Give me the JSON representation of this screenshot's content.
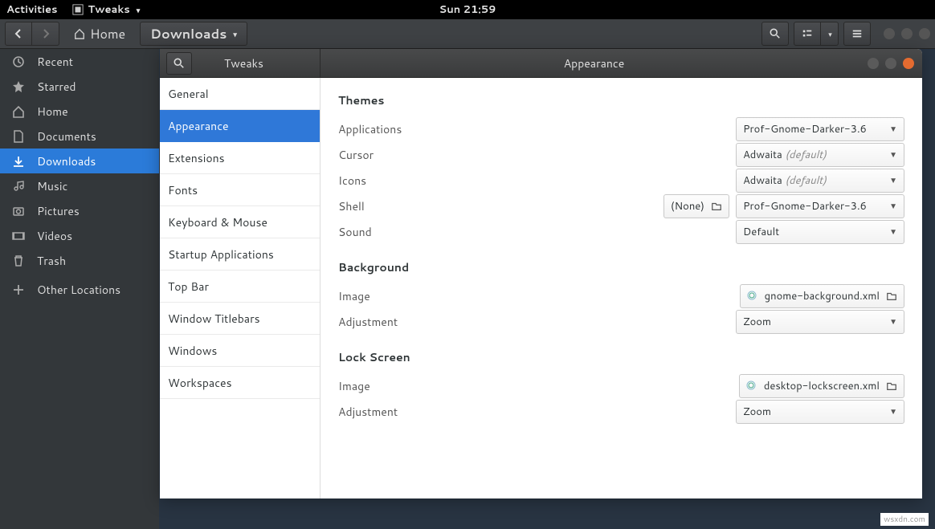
{
  "top_panel": {
    "activities": "Activities",
    "app_menu": "Tweaks",
    "clock": "Sun 21:59"
  },
  "files_header": {
    "home": "Home",
    "current": "Downloads"
  },
  "files_sidebar": {
    "items": [
      {
        "icon": "clock",
        "label": "Recent"
      },
      {
        "icon": "star",
        "label": "Starred"
      },
      {
        "icon": "home",
        "label": "Home"
      },
      {
        "icon": "doc",
        "label": "Documents"
      },
      {
        "icon": "download",
        "label": "Downloads"
      },
      {
        "icon": "music",
        "label": "Music"
      },
      {
        "icon": "camera",
        "label": "Pictures"
      },
      {
        "icon": "video",
        "label": "Videos"
      },
      {
        "icon": "trash",
        "label": "Trash"
      },
      {
        "icon": "plus",
        "label": "Other Locations"
      }
    ]
  },
  "tweaks": {
    "title_left": "Tweaks",
    "title_center": "Appearance",
    "categories": [
      "General",
      "Appearance",
      "Extensions",
      "Fonts",
      "Keyboard & Mouse",
      "Startup Applications",
      "Top Bar",
      "Window Titlebars",
      "Windows",
      "Workspaces"
    ],
    "selected_category_index": 1,
    "sections": {
      "themes": {
        "title": "Themes",
        "rows": {
          "applications": {
            "label": "Applications",
            "value": "Prof-Gnome-Darker-3.6"
          },
          "cursor": {
            "label": "Cursor",
            "value": "Adwaita",
            "default_suffix": "(default)"
          },
          "icons": {
            "label": "Icons",
            "value": "Adwaita",
            "default_suffix": "(default)"
          },
          "shell": {
            "label": "Shell",
            "none": "(None)",
            "value": "Prof-Gnome-Darker-3.6"
          },
          "sound": {
            "label": "Sound",
            "value": "Default"
          }
        }
      },
      "background": {
        "title": "Background",
        "rows": {
          "image": {
            "label": "Image",
            "value": "gnome-background.xml"
          },
          "adjustment": {
            "label": "Adjustment",
            "value": "Zoom"
          }
        }
      },
      "lockscreen": {
        "title": "Lock Screen",
        "rows": {
          "image": {
            "label": "Image",
            "value": "desktop-lockscreen.xml"
          },
          "adjustment": {
            "label": "Adjustment",
            "value": "Zoom"
          }
        }
      }
    }
  },
  "watermark": "wsxdn.com"
}
